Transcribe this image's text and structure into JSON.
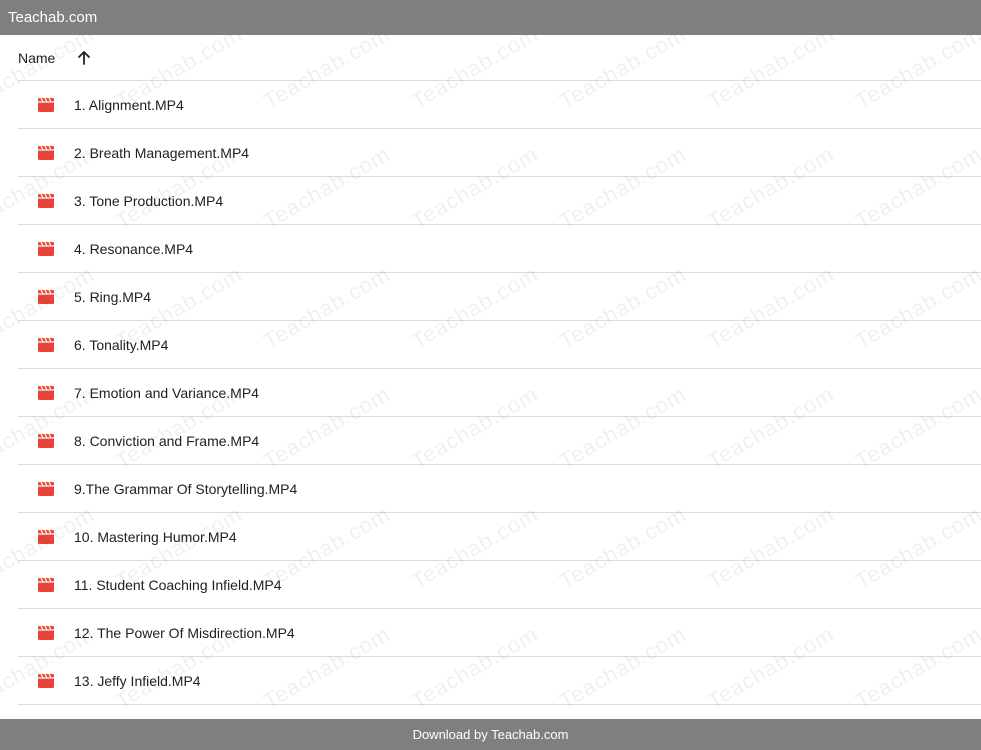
{
  "topbar": {
    "title": "Teachab.com"
  },
  "header": {
    "column_name": "Name",
    "sort_icon": "arrow-up-icon"
  },
  "files": [
    {
      "name": "1. Alignment.MP4",
      "icon": "video-file-icon"
    },
    {
      "name": "2. Breath Management.MP4",
      "icon": "video-file-icon"
    },
    {
      "name": "3. Tone Production.MP4",
      "icon": "video-file-icon"
    },
    {
      "name": "4. Resonance.MP4",
      "icon": "video-file-icon"
    },
    {
      "name": "5. Ring.MP4",
      "icon": "video-file-icon"
    },
    {
      "name": "6. Tonality.MP4",
      "icon": "video-file-icon"
    },
    {
      "name": "7. Emotion and Variance.MP4",
      "icon": "video-file-icon"
    },
    {
      "name": "8. Conviction and Frame.MP4",
      "icon": "video-file-icon"
    },
    {
      "name": "9.The Grammar Of Storytelling.MP4",
      "icon": "video-file-icon"
    },
    {
      "name": "10. Mastering Humor.MP4",
      "icon": "video-file-icon"
    },
    {
      "name": "11. Student Coaching Infield.MP4",
      "icon": "video-file-icon"
    },
    {
      "name": "12. The Power Of Misdirection.MP4",
      "icon": "video-file-icon"
    },
    {
      "name": "13. Jeffy Infield.MP4",
      "icon": "video-file-icon"
    }
  ],
  "footer": {
    "text": "Download by Teachab.com"
  },
  "watermark": {
    "text": "Teachab.com"
  },
  "colors": {
    "bar": "#7f7f7f",
    "icon": "#ea4335",
    "divider": "#dadce0"
  }
}
